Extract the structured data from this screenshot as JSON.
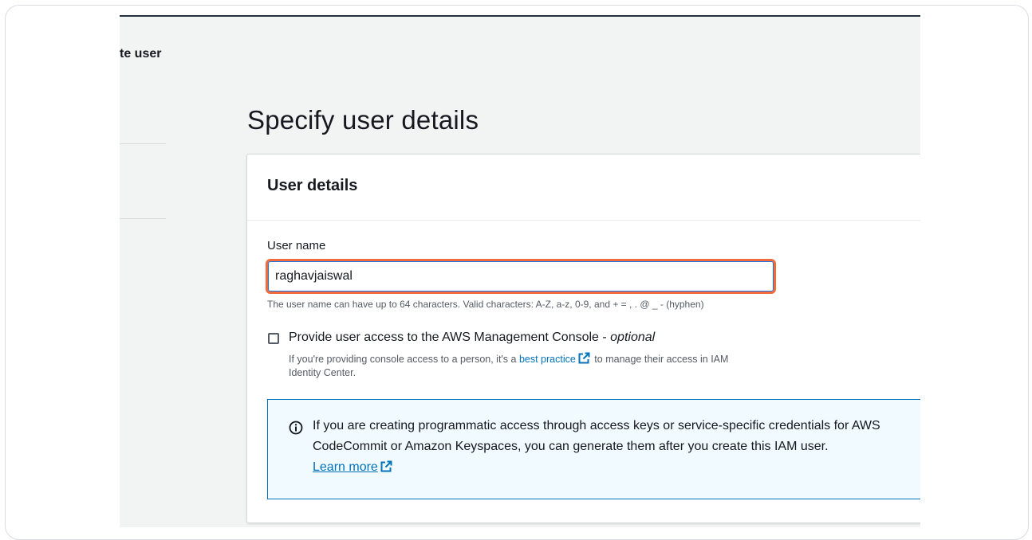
{
  "sidebar": {
    "title": "te user"
  },
  "page": {
    "title": "Specify user details"
  },
  "panel": {
    "title": "User details",
    "user_name_label": "User name",
    "user_name_value": "raghavjaiswal",
    "user_name_hint": "The user name can have up to 64 characters. Valid characters: A-Z, a-z, 0-9, and + = , . @ _ - (hyphen)",
    "console_access": {
      "label": "Provide user access to the AWS Management Console - ",
      "optional": "optional",
      "checked": false,
      "desc_before": "If you're providing console access to a person, it's a ",
      "desc_link": "best practice",
      "desc_after": " to manage their access in IAM Identity Center."
    },
    "alert": {
      "text": "If you are creating programmatic access through access keys or service-specific credentials for AWS CodeCommit or Amazon Keyspaces, you can generate them after you create this IAM user.",
      "link": "Learn more"
    }
  },
  "colors": {
    "accent": "#0073bb",
    "highlight": "#f26b3a",
    "alert_bg": "#f1faff",
    "text": "#16191f"
  },
  "icons": {
    "external": "external-link-icon",
    "info": "info-icon"
  }
}
